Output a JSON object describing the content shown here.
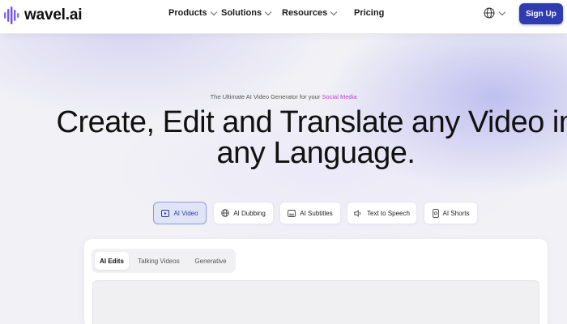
{
  "brand": {
    "name": "wavel.ai"
  },
  "nav": {
    "items": [
      {
        "label": "Products",
        "has_dropdown": true
      },
      {
        "label": "Solutions",
        "has_dropdown": true
      },
      {
        "label": "Resources",
        "has_dropdown": true
      },
      {
        "label": "Pricing",
        "has_dropdown": false
      }
    ],
    "language_icon": "globe-icon",
    "signup_label": "Sign Up"
  },
  "hero": {
    "tagline_prefix": "The Ultimate AI Video Generator for your",
    "tagline_accent": "Social Media",
    "headline": "Create, Edit and Translate any Video in any Language."
  },
  "feature_tabs": [
    {
      "label": "AI Video",
      "icon": "video-icon",
      "active": true
    },
    {
      "label": "AI Dubbing",
      "icon": "globe-icon",
      "active": false
    },
    {
      "label": "AI Subtitles",
      "icon": "subtitles-icon",
      "active": false
    },
    {
      "label": "Text to Speech",
      "icon": "speaker-icon",
      "active": false
    },
    {
      "label": "AI Shorts",
      "icon": "phone-icon",
      "active": false
    }
  ],
  "panel": {
    "subtabs": [
      {
        "label": "AI Edits",
        "active": true
      },
      {
        "label": "Talking Videos",
        "active": false
      },
      {
        "label": "Generative",
        "active": false
      }
    ]
  },
  "colors": {
    "accent": "#2f3bb0",
    "tagline_accent": "#c03ad3",
    "active_tab_bg": "#dfe4f7",
    "logo_purple": "#7b5cf0"
  }
}
